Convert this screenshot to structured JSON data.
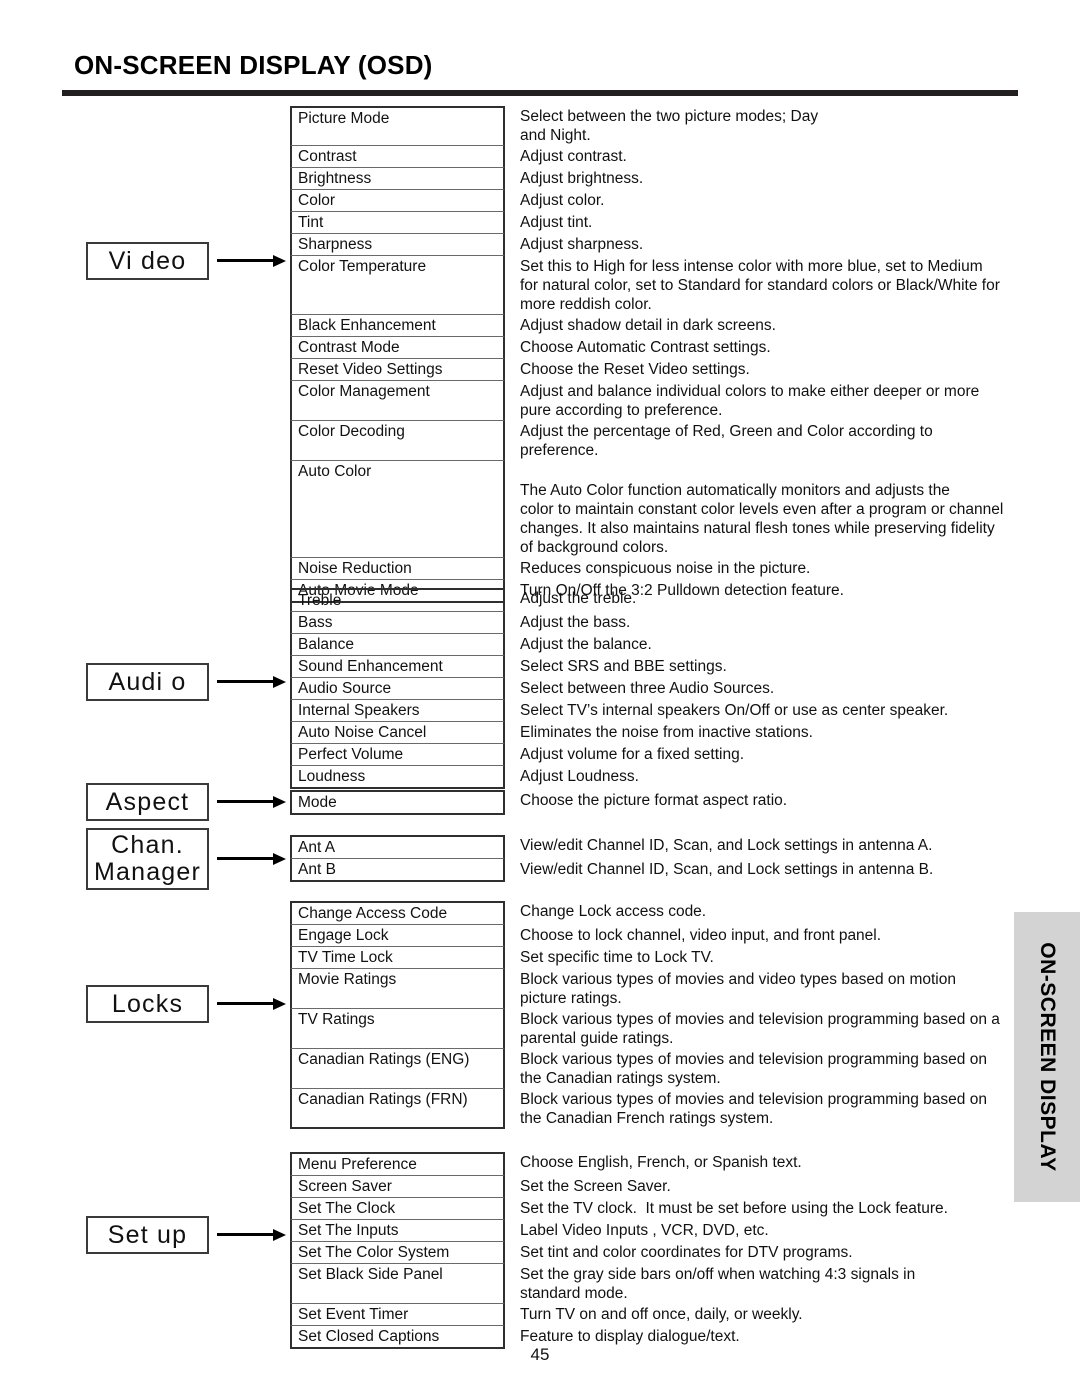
{
  "page": {
    "title": "ON-SCREEN DISPLAY (OSD)",
    "number": "45",
    "side_tab_label": "ON-SCREEN DISPLAY",
    "rule_color": "#231f20",
    "side_tab_color": "#d3d3d3"
  },
  "categories": [
    {
      "id": "video",
      "label": "Vi deo"
    },
    {
      "id": "audio",
      "label": "Audi o"
    },
    {
      "id": "aspect",
      "label": "Aspect"
    },
    {
      "id": "chan",
      "label": "Chan.\nManager"
    },
    {
      "id": "locks",
      "label": "Locks"
    },
    {
      "id": "setup",
      "label": "Set up"
    }
  ],
  "sections": {
    "video": {
      "rows": [
        {
          "name": "Picture Mode",
          "desc": [
            "Select between the two picture modes; Day",
            "and Night."
          ]
        },
        {
          "name": "Contrast",
          "desc": [
            "Adjust contrast."
          ]
        },
        {
          "name": "Brightness",
          "desc": [
            "Adjust brightness."
          ]
        },
        {
          "name": "Color",
          "desc": [
            "Adjust color."
          ]
        },
        {
          "name": "Tint",
          "desc": [
            "Adjust tint."
          ]
        },
        {
          "name": "Sharpness",
          "desc": [
            "Adjust sharpness."
          ]
        },
        {
          "name": "Color Temperature",
          "desc": [
            "Set this to High for less intense color with more blue, set to Medium",
            "for natural color, set to Standard for standard colors or Black/White for",
            "more reddish color."
          ]
        },
        {
          "name": "Black Enhancement",
          "desc": [
            "Adjust shadow detail in dark screens."
          ]
        },
        {
          "name": "Contrast Mode",
          "desc": [
            "Choose Automatic Contrast settings."
          ]
        },
        {
          "name": "Reset Video Settings",
          "desc": [
            "Choose the Reset Video settings."
          ]
        },
        {
          "name": "Color Management",
          "desc": [
            "Adjust and balance individual colors to make either deeper or more",
            "pure according to preference."
          ]
        },
        {
          "name": "Color Decoding",
          "desc": [
            "Adjust the percentage of Red, Green and Color according to",
            "preference."
          ]
        },
        {
          "name": "Auto Color",
          "desc": [
            "",
            "The Auto Color function automatically monitors and adjusts the",
            "color to maintain constant color levels even after a program or channel",
            "changes. It also maintains natural flesh tones while preserving fidelity",
            "of background colors."
          ]
        },
        {
          "name": "Noise Reduction",
          "desc": [
            "Reduces conspicuous noise in the picture."
          ]
        },
        {
          "name": "Auto Movie Mode",
          "desc": [
            "Turn On/Off the 3:2 Pulldown detection feature."
          ]
        }
      ]
    },
    "audio": {
      "rows": [
        {
          "name": "Treble",
          "desc": [
            "Adjust the treble."
          ]
        },
        {
          "name": "Bass",
          "desc": [
            "Adjust the bass."
          ]
        },
        {
          "name": "Balance",
          "desc": [
            "Adjust the balance."
          ]
        },
        {
          "name": "Sound Enhancement",
          "desc": [
            "Select SRS and BBE settings."
          ]
        },
        {
          "name": "Audio Source",
          "desc": [
            "Select between three Audio Sources."
          ]
        },
        {
          "name": "Internal Speakers",
          "desc": [
            "Select TV’s internal speakers On/Off or use as center speaker."
          ]
        },
        {
          "name": "Auto Noise Cancel",
          "desc": [
            "Eliminates the noise from inactive stations."
          ]
        },
        {
          "name": "Perfect Volume",
          "desc": [
            "Adjust volume for a fixed setting."
          ]
        },
        {
          "name": "Loudness",
          "desc": [
            "Adjust Loudness."
          ]
        }
      ]
    },
    "aspect": {
      "rows": [
        {
          "name": "Mode",
          "desc": [
            "Choose the picture format aspect ratio."
          ]
        }
      ]
    },
    "chan": {
      "rows": [
        {
          "name": "Ant A",
          "desc": [
            "View/edit Channel ID, Scan, and Lock settings in antenna A."
          ]
        },
        {
          "name": "Ant B",
          "desc": [
            "View/edit Channel ID, Scan, and Lock settings in antenna B."
          ]
        }
      ]
    },
    "locks": {
      "rows": [
        {
          "name": "Change Access Code",
          "desc": [
            "Change Lock access code."
          ]
        },
        {
          "name": "Engage Lock",
          "desc": [
            "Choose to lock channel, video input, and front panel."
          ]
        },
        {
          "name": "TV Time Lock",
          "desc": [
            "Set specific time to Lock TV."
          ]
        },
        {
          "name": "Movie Ratings",
          "desc": [
            "Block various types of movies and video types based on motion",
            "picture ratings."
          ]
        },
        {
          "name": "TV Ratings",
          "desc": [
            "Block various types of movies and television programming based on a",
            "parental guide ratings."
          ]
        },
        {
          "name": "Canadian Ratings (ENG)",
          "desc": [
            "Block various types of movies and television programming based on",
            "the Canadian ratings system."
          ]
        },
        {
          "name": "Canadian Ratings (FRN)",
          "desc": [
            "Block various types of movies and television programming based on",
            "the Canadian French ratings system."
          ]
        }
      ]
    },
    "setup": {
      "rows": [
        {
          "name": "Menu Preference",
          "desc": [
            "Choose English, French, or Spanish text."
          ]
        },
        {
          "name": "Screen Saver",
          "desc": [
            "Set the Screen Saver."
          ]
        },
        {
          "name": "Set The Clock",
          "desc": [
            "Set the TV clock.  It must be set before using the Lock feature."
          ]
        },
        {
          "name": "Set The Inputs",
          "desc": [
            "Label Video Inputs , VCR, DVD, etc."
          ]
        },
        {
          "name": "Set The Color System",
          "desc": [
            "Set tint and color coordinates for DTV programs."
          ]
        },
        {
          "name": "Set Black Side Panel",
          "desc": [
            "Set the gray side bars on/off when watching 4:3 signals in",
            "standard mode."
          ]
        },
        {
          "name": "Set Event Timer",
          "desc": [
            "Turn TV on and off once, daily, or weekly."
          ]
        },
        {
          "name": "Set Closed Captions",
          "desc": [
            "Feature to display dialogue/text."
          ]
        }
      ]
    }
  }
}
